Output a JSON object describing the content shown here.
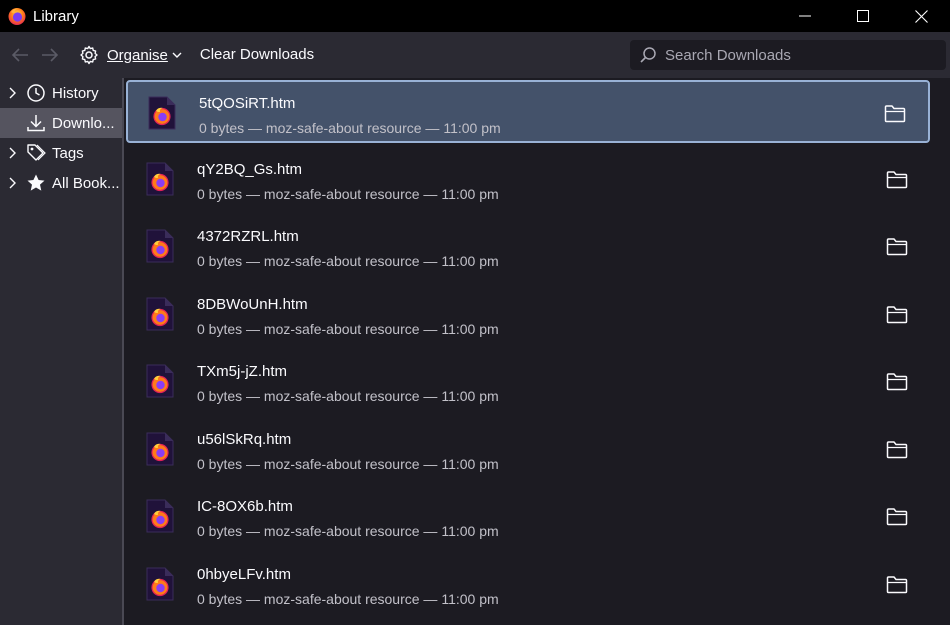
{
  "window": {
    "title": "Library",
    "app_icon": "firefox-icon",
    "controls": [
      "minimize-icon",
      "maximize-icon",
      "close-icon"
    ]
  },
  "toolbar": {
    "back_icon": "arrow-left-icon",
    "forward_icon": "arrow-right-icon",
    "organise_label": "Organise",
    "clear_label": "Clear Downloads",
    "search_placeholder": "Search Downloads"
  },
  "sidebar": {
    "items": [
      {
        "label": "History",
        "icon": "clock-icon",
        "expandable": true,
        "selected": false
      },
      {
        "label": "Downlo...",
        "icon": "download-icon",
        "expandable": false,
        "selected": true
      },
      {
        "label": "Tags",
        "icon": "tags-icon",
        "expandable": true,
        "selected": false
      },
      {
        "label": "All Book...",
        "icon": "star-icon",
        "expandable": true,
        "selected": false
      }
    ]
  },
  "downloads": [
    {
      "name": "5tQOSiRT.htm",
      "meta": "0 bytes — moz-safe-about resource — 11:00 pm",
      "selected": true
    },
    {
      "name": "qY2BQ_Gs.htm",
      "meta": "0 bytes — moz-safe-about resource — 11:00 pm",
      "selected": false
    },
    {
      "name": "4372RZRL.htm",
      "meta": "0 bytes — moz-safe-about resource — 11:00 pm",
      "selected": false
    },
    {
      "name": "8DBWoUnH.htm",
      "meta": "0 bytes — moz-safe-about resource — 11:00 pm",
      "selected": false
    },
    {
      "name": "TXm5j-jZ.htm",
      "meta": "0 bytes — moz-safe-about resource — 11:00 pm",
      "selected": false
    },
    {
      "name": "u56lSkRq.htm",
      "meta": "0 bytes — moz-safe-about resource — 11:00 pm",
      "selected": false
    },
    {
      "name": "IC-8OX6b.htm",
      "meta": "0 bytes — moz-safe-about resource — 11:00 pm",
      "selected": false
    },
    {
      "name": "0hbyeLFv.htm",
      "meta": "0 bytes — moz-safe-about resource — 11:00 pm",
      "selected": false
    }
  ],
  "colors": {
    "titlebar": "#000000",
    "toolbar": "#2b2a33",
    "list_bg": "#1c1b22",
    "selected_row": "#44526a",
    "selected_border": "#99b2d6"
  }
}
